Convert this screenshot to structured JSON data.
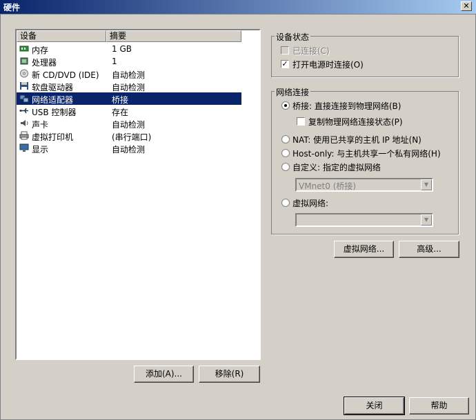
{
  "window": {
    "title": "硬件",
    "close_glyph": "✕"
  },
  "device_list": {
    "columns": [
      "设备",
      "摘要"
    ],
    "rows": [
      {
        "name": "内存",
        "summary": "1 GB",
        "icon": "memory-icon"
      },
      {
        "name": "处理器",
        "summary": "1",
        "icon": "processor-icon"
      },
      {
        "name": "新 CD/DVD (IDE)",
        "summary": "自动检测",
        "icon": "cdrom-icon"
      },
      {
        "name": "软盘驱动器",
        "summary": "自动检测",
        "icon": "floppy-icon"
      },
      {
        "name": "网络适配器",
        "summary": "桥接",
        "icon": "network-adapter-icon",
        "selected": true
      },
      {
        "name": "USB 控制器",
        "summary": "存在",
        "icon": "usb-icon"
      },
      {
        "name": "声卡",
        "summary": "自动检测",
        "icon": "sound-icon"
      },
      {
        "name": "虚拟打印机",
        "summary": "(串行端口)",
        "icon": "printer-icon"
      },
      {
        "name": "显示",
        "summary": "自动检测",
        "icon": "display-icon"
      }
    ]
  },
  "list_buttons": {
    "add": "添加(A)...",
    "remove": "移除(R)"
  },
  "device_status": {
    "legend": "设备状态",
    "connected": {
      "label": "已连接(C)",
      "checked": false,
      "disabled": true
    },
    "connect_on_power": {
      "label": "打开电源时连接(O)",
      "checked": true
    }
  },
  "network": {
    "legend": "网络连接",
    "bridged": "桥接: 直接连接到物理网络(B)",
    "replicate": "复制物理网络连接状态(P)",
    "nat": "NAT: 使用已共享的主机 IP 地址(N)",
    "hostonly": "Host-only: 与主机共享一个私有网络(H)",
    "custom": "自定义: 指定的虚拟网络",
    "custom_value": "VMnet0 (桥接)",
    "vnet": "虚拟网络:",
    "vnet_value": "",
    "selected": "bridged"
  },
  "side_buttons": {
    "virtual_network": "虚拟网络...",
    "advanced": "高级..."
  },
  "footer": {
    "close": "关闭",
    "help": "帮助"
  }
}
